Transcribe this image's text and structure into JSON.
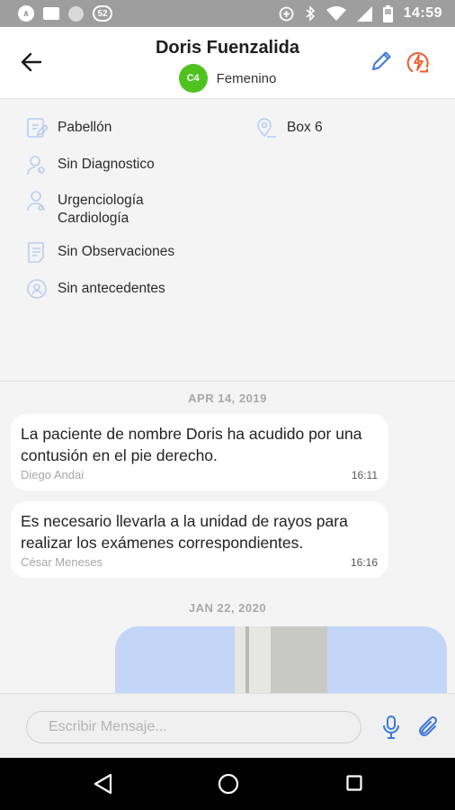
{
  "status_bar": {
    "time": "14:59",
    "notification_count": "52",
    "icons": [
      "app-icon",
      "image-icon",
      "circle-icon",
      "badge-icon",
      "add-circle-icon",
      "bluetooth-icon",
      "wifi-icon",
      "signal-icon",
      "battery-icon"
    ]
  },
  "header": {
    "patient_name": "Doris Fuenzalida",
    "badge": "C4",
    "gender": "Femenino",
    "colors": {
      "badge": "#4fc220",
      "edit_icon": "#3b78d8",
      "alert_icon": "#f05a28"
    }
  },
  "info": {
    "pavilion": "Pabellón",
    "box": "Box 6",
    "diagnosis": "Sin Diagnostico",
    "specialty_1": "Urgenciología",
    "specialty_2": "Cardiología",
    "observations": "Sin Observaciones",
    "antecedents": "Sin antecedentes"
  },
  "chat": {
    "date_1": "APR 14, 2019",
    "messages": [
      {
        "text": "La paciente de nombre Doris ha acudido por una contusión en el pie derecho.",
        "author": "Diego Andai",
        "time": "16:11"
      },
      {
        "text": "Es necesario llevarla a la unidad de rayos para realizar los exámenes correspondientes.",
        "author": "César Meneses",
        "time": "16:16"
      }
    ],
    "date_2": "JAN 22, 2020"
  },
  "composer": {
    "placeholder": "Escribir Mensaje..."
  }
}
